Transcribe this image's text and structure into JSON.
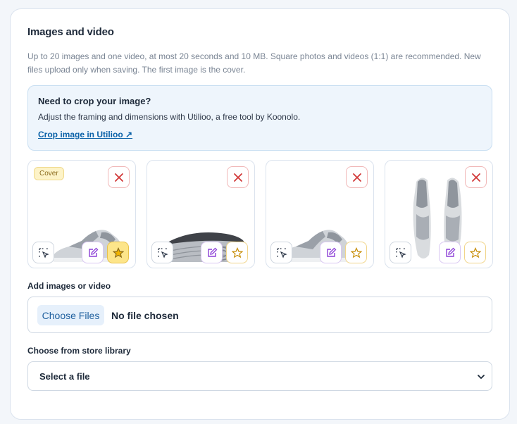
{
  "section": {
    "title": "Images and video",
    "description": "Up to 20 images and one video, at most 20 seconds and 10 MB. Square photos and videos (1:1) are recommended. New files upload only when saving. The first image is the cover."
  },
  "notice": {
    "title": "Need to crop your image?",
    "text": "Adjust the framing and dimensions with Utilioo, a free tool by Koonolo.",
    "link_label": "Crop image in Utilioo ↗"
  },
  "media": {
    "cover_label": "Cover",
    "items": [
      {
        "image": "sneaker-side-view",
        "is_cover": true
      },
      {
        "image": "sneaker-sole-view",
        "is_cover": false
      },
      {
        "image": "sneaker-side-view",
        "is_cover": false
      },
      {
        "image": "sneaker-pair-top-view",
        "is_cover": false
      }
    ],
    "icons": {
      "remove": "close-icon",
      "select": "select-cursor-icon",
      "edit": "edit-icon",
      "cover": "star-icon"
    }
  },
  "upload": {
    "label": "Add images or video",
    "button_label": "Choose Files",
    "status": "No file chosen"
  },
  "library": {
    "label": "Choose from store library",
    "selected": "Select a file"
  },
  "colors": {
    "accent": "#0b62a8",
    "notice_bg": "#eef5fc",
    "remove": "#d23b3b",
    "edit": "#8b3fd6",
    "star": "#c58a00",
    "star_active_bg": "#fde58a"
  }
}
